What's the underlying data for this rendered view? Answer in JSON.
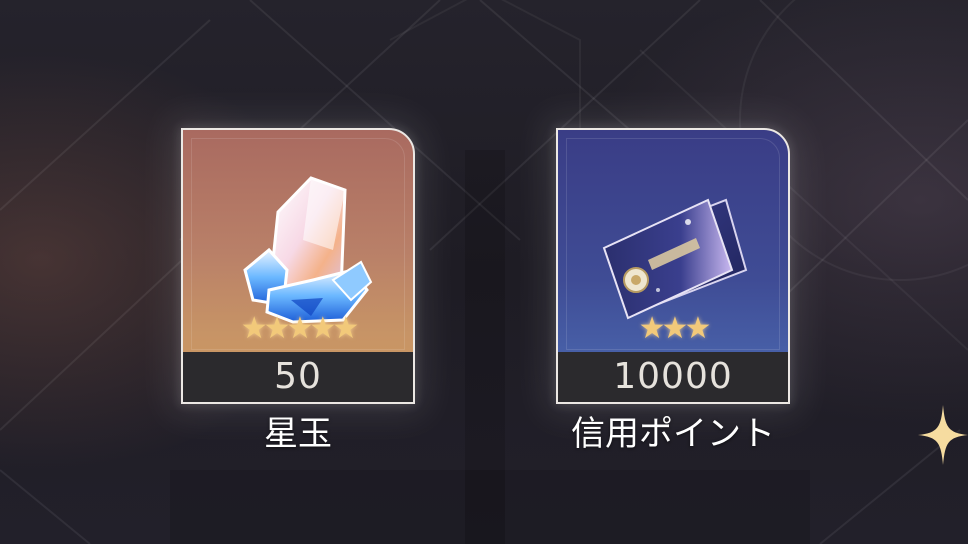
{
  "rewards": [
    {
      "name": "星玉",
      "quantity": "50",
      "stars": 5,
      "stars_text": "★★★★★",
      "icon": "stellar-jade-crystal-icon",
      "card_color": "#b98068"
    },
    {
      "name": "信用ポイント",
      "quantity": "10000",
      "stars": 3,
      "stars_text": "★★★",
      "icon": "credit-card-icon",
      "card_color": "#3f4c95"
    }
  ],
  "colors": {
    "star": "#f2c97a",
    "frame": "#ece8e4",
    "quantity_bar": "#2b2a2d"
  }
}
